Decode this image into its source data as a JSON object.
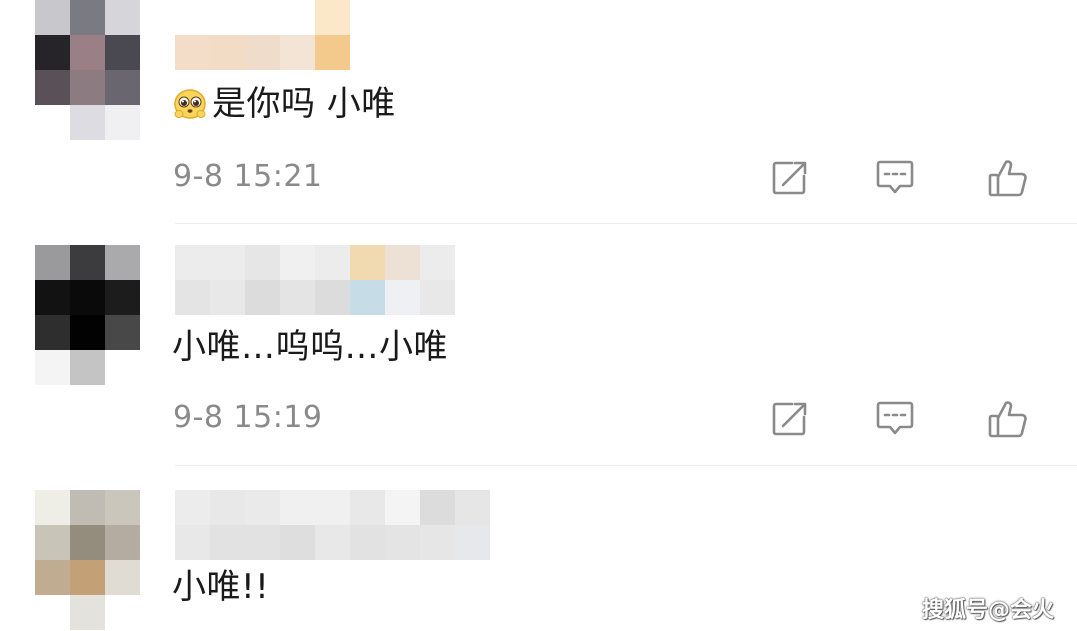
{
  "comments": [
    {
      "text": "是你吗 小唯",
      "time": "9-8 15:21",
      "has_emoji": true,
      "avatar_colors": [
        "#c8c8cc",
        "#7a7a82",
        "#d6d6da",
        "#262428",
        "#9a7f86",
        "#4a4850",
        "#5a5058",
        "#8c7c82",
        "#6a6670",
        "#ffffff",
        "#dcdce2",
        "#f0f0f2"
      ],
      "name_colors": [
        "#ffffff",
        "#ffffff",
        "#ffffff",
        "#ffffff",
        "#fbe8c8",
        "#f3dcc8",
        "#f2dcc6",
        "#f0dccb",
        "#f4e4d6",
        "#f4c98c"
      ]
    },
    {
      "text": "小唯…呜呜…小唯",
      "time": "9-8 15:19",
      "has_emoji": false,
      "avatar_colors": [
        "#9a9a9c",
        "#3c3c3e",
        "#aaaaac",
        "#121212",
        "#0a0a0a",
        "#1c1c1c",
        "#2e2e2e",
        "#020202",
        "#484848",
        "#f4f4f4",
        "#c4c4c4",
        "#ffffff"
      ],
      "name_colors": [
        "#ececec",
        "#ececec",
        "#e6e6e6",
        "#f0f0f0",
        "#ececec",
        "#f1d9b0",
        "#ede0d4",
        "#ececec",
        "#e4e4e4",
        "#e8e8e8",
        "#dcdcdc",
        "#e4e4e4",
        "#dcdcdc",
        "#c6dde8",
        "#eef0f4",
        "#e8e8e8"
      ]
    },
    {
      "text": "小唯!!",
      "time": "",
      "has_emoji": false,
      "avatar_colors": [
        "#eeeee6",
        "#c0bcb4",
        "#cac6bc",
        "#c8c4b8",
        "#948c7c",
        "#b4aca0",
        "#c0ac90",
        "#c4a076",
        "#e0dcd4",
        "#ffffff",
        "#e4e2dc",
        "#ffffff"
      ],
      "name_colors": [
        "#ececec",
        "#e8e8e8",
        "#eaeaea",
        "#f0f0f0",
        "#f0f0f0",
        "#e8e8e8",
        "#f4f4f4",
        "#dcdcdc",
        "#e6e6e6",
        "#e8e8e8",
        "#e2e2e2",
        "#e2e2e2",
        "#dedede",
        "#e8e8e8",
        "#e2e2e2",
        "#e4e4e4",
        "#e6e6e6",
        "#e6e8ec"
      ]
    }
  ],
  "actions": {
    "share_icon": "share-icon",
    "reply_icon": "comment-icon",
    "like_icon": "thumbs-up-icon"
  },
  "watermark": "搜狐号@会火",
  "colors": {
    "text": "#1a1a1a",
    "time": "#8a8a8a",
    "icon": "#8a8a8a",
    "divider": "#ececec"
  }
}
